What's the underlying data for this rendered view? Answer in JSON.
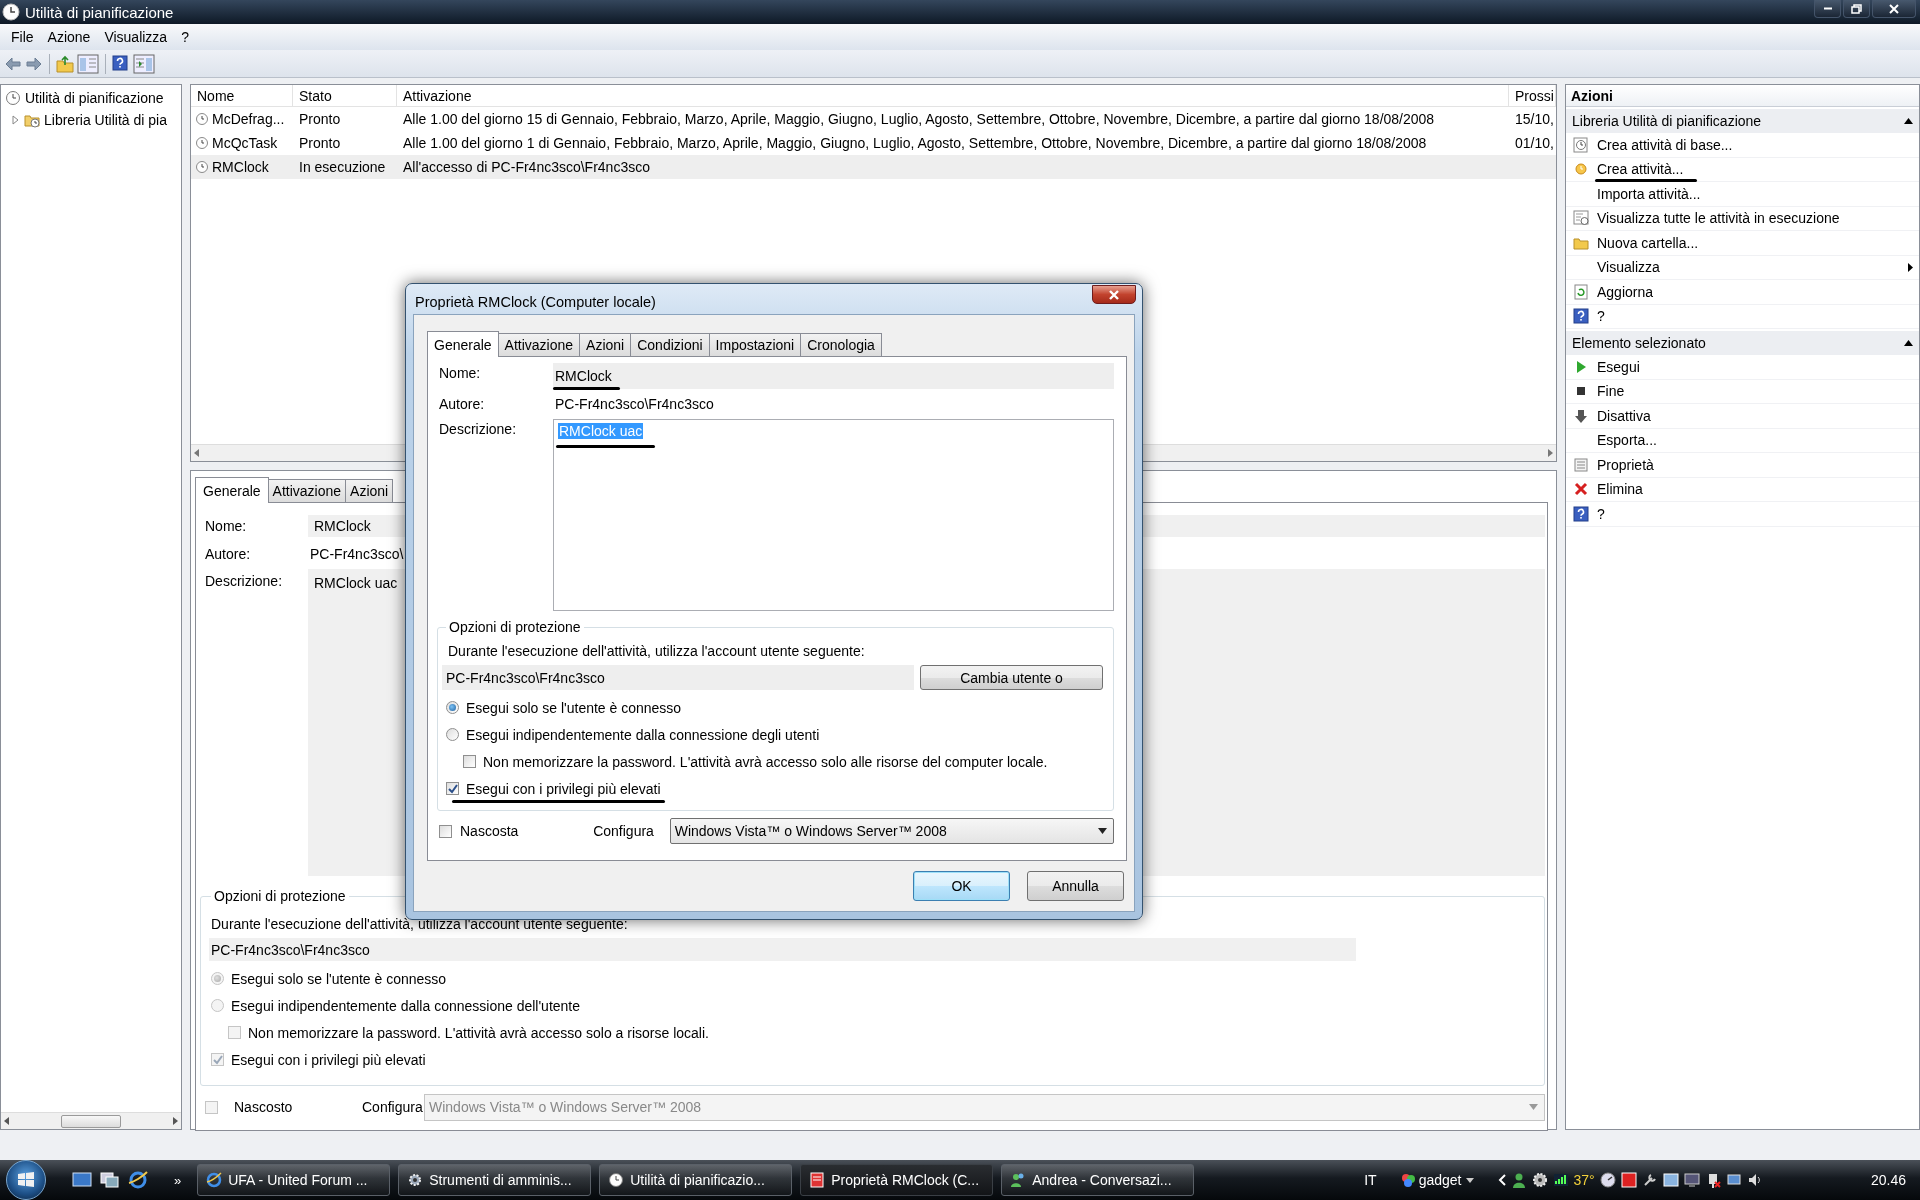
{
  "window": {
    "title": "Utilità di pianificazione"
  },
  "menu": [
    "File",
    "Azione",
    "Visualizza",
    "?"
  ],
  "tree": [
    {
      "label": "Utilità di pianificazione",
      "children": [
        {
          "label": "Libreria Utilità di pia",
          "expanded": false
        }
      ]
    }
  ],
  "task_list": {
    "columns": [
      "Nome",
      "Stato",
      "Attivazione",
      "Prossi"
    ],
    "rows": [
      {
        "name": "McDefrag...",
        "status": "Pronto",
        "trigger": "Alle 1.00 del giorno 15 di Gennaio, Febbraio, Marzo, Aprile, Maggio, Giugno, Luglio, Agosto, Settembre, Ottobre, Novembre, Dicembre, a partire dal giorno 18/08/2008",
        "next": "15/10,",
        "selected": false
      },
      {
        "name": "McQcTask",
        "status": "Pronto",
        "trigger": "Alle 1.00 del giorno 1 di Gennaio, Febbraio, Marzo, Aprile, Maggio, Giugno, Luglio, Agosto, Settembre, Ottobre, Novembre, Dicembre, a partire dal giorno 18/08/2008",
        "next": "01/10,",
        "selected": false
      },
      {
        "name": "RMClock",
        "status": "In esecuzione",
        "trigger": "All'accesso di PC-Fr4nc3sco\\Fr4nc3sco",
        "selected": true
      }
    ]
  },
  "details": {
    "disabled": true,
    "tabs": [
      {
        "label": "Generale",
        "selected": true
      },
      {
        "label": "Attivazione",
        "selected": false
      },
      {
        "label": "Azioni",
        "selected": false
      }
    ],
    "name_label": "Nome:",
    "name": "RMClock",
    "author_label": "Autore:",
    "author": "PC-Fr4nc3sco\\",
    "description_label": "Descrizione:",
    "description": "RMClock uac",
    "security": {
      "title": "Opzioni di protezione",
      "account_label": "Durante l'esecuzione dell'attività, utilizza l'account utente seguente:",
      "account": "PC-Fr4nc3sco\\Fr4nc3sco",
      "options": [
        {
          "kind": "radio",
          "label": "Esegui solo se l'utente è connesso",
          "checked": true
        },
        {
          "kind": "radio",
          "label": "Esegui indipendentemente dalla connessione dell'utente",
          "checked": false
        },
        {
          "kind": "subcheckbox",
          "label": "Non memorizzare la password. L'attività avrà accesso solo a risorse locali.",
          "checked": false
        },
        {
          "kind": "checkbox",
          "label": "Esegui con i privilegi più elevati",
          "checked": true
        }
      ]
    },
    "hidden": {
      "label": "Nascosto",
      "checked": false
    },
    "configure_label": "Configura",
    "configure": "Windows Vista™ o Windows Server™ 2008"
  },
  "actions_panel": {
    "title": "Azioni",
    "sections": [
      {
        "title": "Libreria Utilità di pianificazione",
        "expanded": true,
        "items": [
          {
            "label": "Crea attività di base..."
          },
          {
            "label": "Crea attività..."
          },
          {
            "label": "Importa attività..."
          },
          {
            "label": "Visualizza tutte le attività in esecuzione"
          },
          {
            "label": "Nuova cartella..."
          },
          {
            "label": "Visualizza",
            "submenu": true
          },
          {
            "label": "Aggiorna"
          },
          {
            "label": "?"
          }
        ]
      },
      {
        "title": "Elemento selezionato",
        "expanded": true,
        "items": [
          {
            "label": "Esegui"
          },
          {
            "label": "Fine"
          },
          {
            "label": "Disattiva"
          },
          {
            "label": "Esporta..."
          },
          {
            "label": "Proprietà"
          },
          {
            "label": "Elimina"
          },
          {
            "label": "?"
          }
        ]
      }
    ]
  },
  "dialog": {
    "title": "Proprietà RMClock (Computer locale)",
    "tabs": [
      {
        "label": "Generale",
        "selected": true
      },
      {
        "label": "Attivazione",
        "selected": false
      },
      {
        "label": "Azioni",
        "selected": false
      },
      {
        "label": "Condizioni",
        "selected": false
      },
      {
        "label": "Impostazioni",
        "selected": false
      },
      {
        "label": "Cronologia",
        "selected": false
      }
    ],
    "name_label": "Nome:",
    "name": "RMClock",
    "author_label": "Autore:",
    "author": "PC-Fr4nc3sco\\Fr4nc3sco",
    "description_label": "Descrizione:",
    "description": "RMClock uac",
    "description_highlighted": true,
    "security": {
      "title": "Opzioni di protezione",
      "account_label": "Durante l'esecuzione dell'attività, utilizza l'account utente seguente:",
      "account": "PC-Fr4nc3sco\\Fr4nc3sco",
      "change_user_button": "Cambia utente o",
      "options": [
        {
          "kind": "radio",
          "label": "Esegui solo se l'utente è connesso",
          "checked": true
        },
        {
          "kind": "radio",
          "label": "Esegui indipendentemente dalla connessione degli utenti",
          "checked": false
        },
        {
          "kind": "subcheckbox",
          "label": "Non memorizzare la password. L'attività avrà accesso solo alle risorse del computer locale.",
          "checked": false
        },
        {
          "kind": "checkbox",
          "label": "Esegui con i privilegi più elevati",
          "checked": true
        }
      ]
    },
    "hidden": {
      "label": "Nascosta",
      "checked": false
    },
    "configure_label": "Configura",
    "configure": "Windows Vista™ o Windows Server™ 2008",
    "buttons": [
      {
        "label": "OK",
        "default": true
      },
      {
        "label": "Annulla",
        "default": false
      }
    ]
  },
  "taskbar": {
    "more": "»",
    "tasks": [
      {
        "label": "UFA - United Forum ...",
        "selected": false
      },
      {
        "label": "Strumenti di amminis...",
        "selected": false
      },
      {
        "label": "Utilità di pianificazio...",
        "selected": false
      },
      {
        "label": "Proprietà RMClock (C...",
        "selected": true
      },
      {
        "label": "Andrea - Conversazi...",
        "selected": false
      }
    ],
    "language": "IT",
    "gadget": "gadget",
    "temperature": "37°",
    "clock": "20.46"
  }
}
